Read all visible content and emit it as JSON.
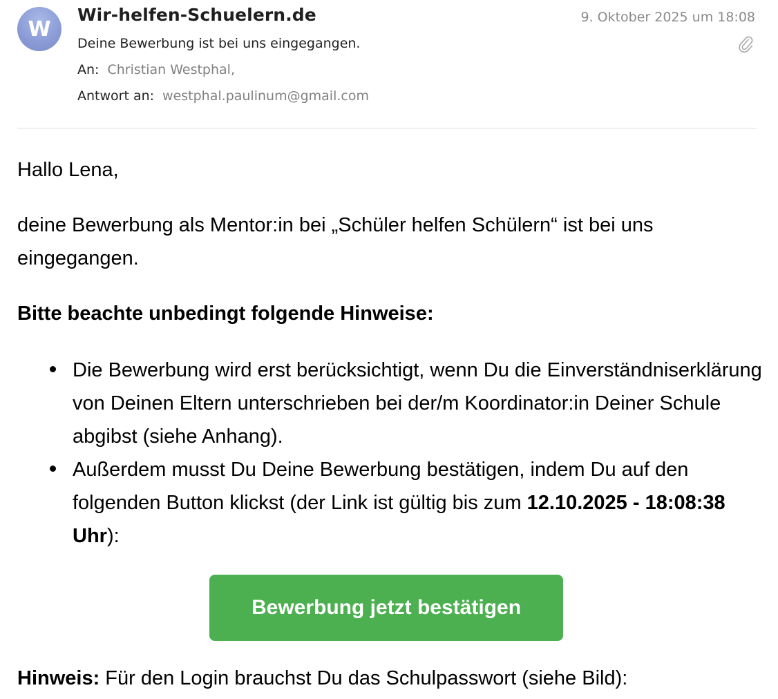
{
  "header": {
    "avatar_letter": "W",
    "sender": "Wir-helfen-Schuelern.de",
    "subject": "Deine Bewerbung ist bei uns eingegangen.",
    "to_label": "An:",
    "to_value": "Christian Westphal,",
    "reply_label": "Antwort an:",
    "reply_value": "westphal.paulinum@gmail.com",
    "date": "9. Oktober 2025 um 18:08",
    "attachment_icon": "paperclip-icon"
  },
  "body": {
    "greeting": "Hallo Lena,",
    "intro": "deine Bewerbung als Mentor:in bei „Schüler helfen Schülern“ ist bei uns eingegangen.",
    "notice_title": "Bitte beachte unbedingt folgende Hinweise:",
    "bullet_1": "Die Bewerbung wird erst berücksichtigt, wenn Du die Einverständniserklärung von Deinen Eltern unterschrieben bei der/m Koordinator:in Deiner Schule abgibst (siehe Anhang).",
    "bullet_2_prefix": "Außerdem musst Du Deine Bewerbung bestätigen, indem Du auf den folgenden Button klickst (der Link ist gültig bis zum ",
    "bullet_2_bold": "12.10.2025 - 18:08:38 Uhr",
    "bullet_2_suffix": "):",
    "confirm_button": "Bewerbung jetzt bestätigen",
    "hint_label": "Hinweis:",
    "hint_text": " Für den Login brauchst Du das Schulpasswort (siehe Bild):"
  },
  "colors": {
    "button_green": "#4caf50",
    "meta_gray": "#808080",
    "avatar_blue": "#8a9ad6"
  }
}
